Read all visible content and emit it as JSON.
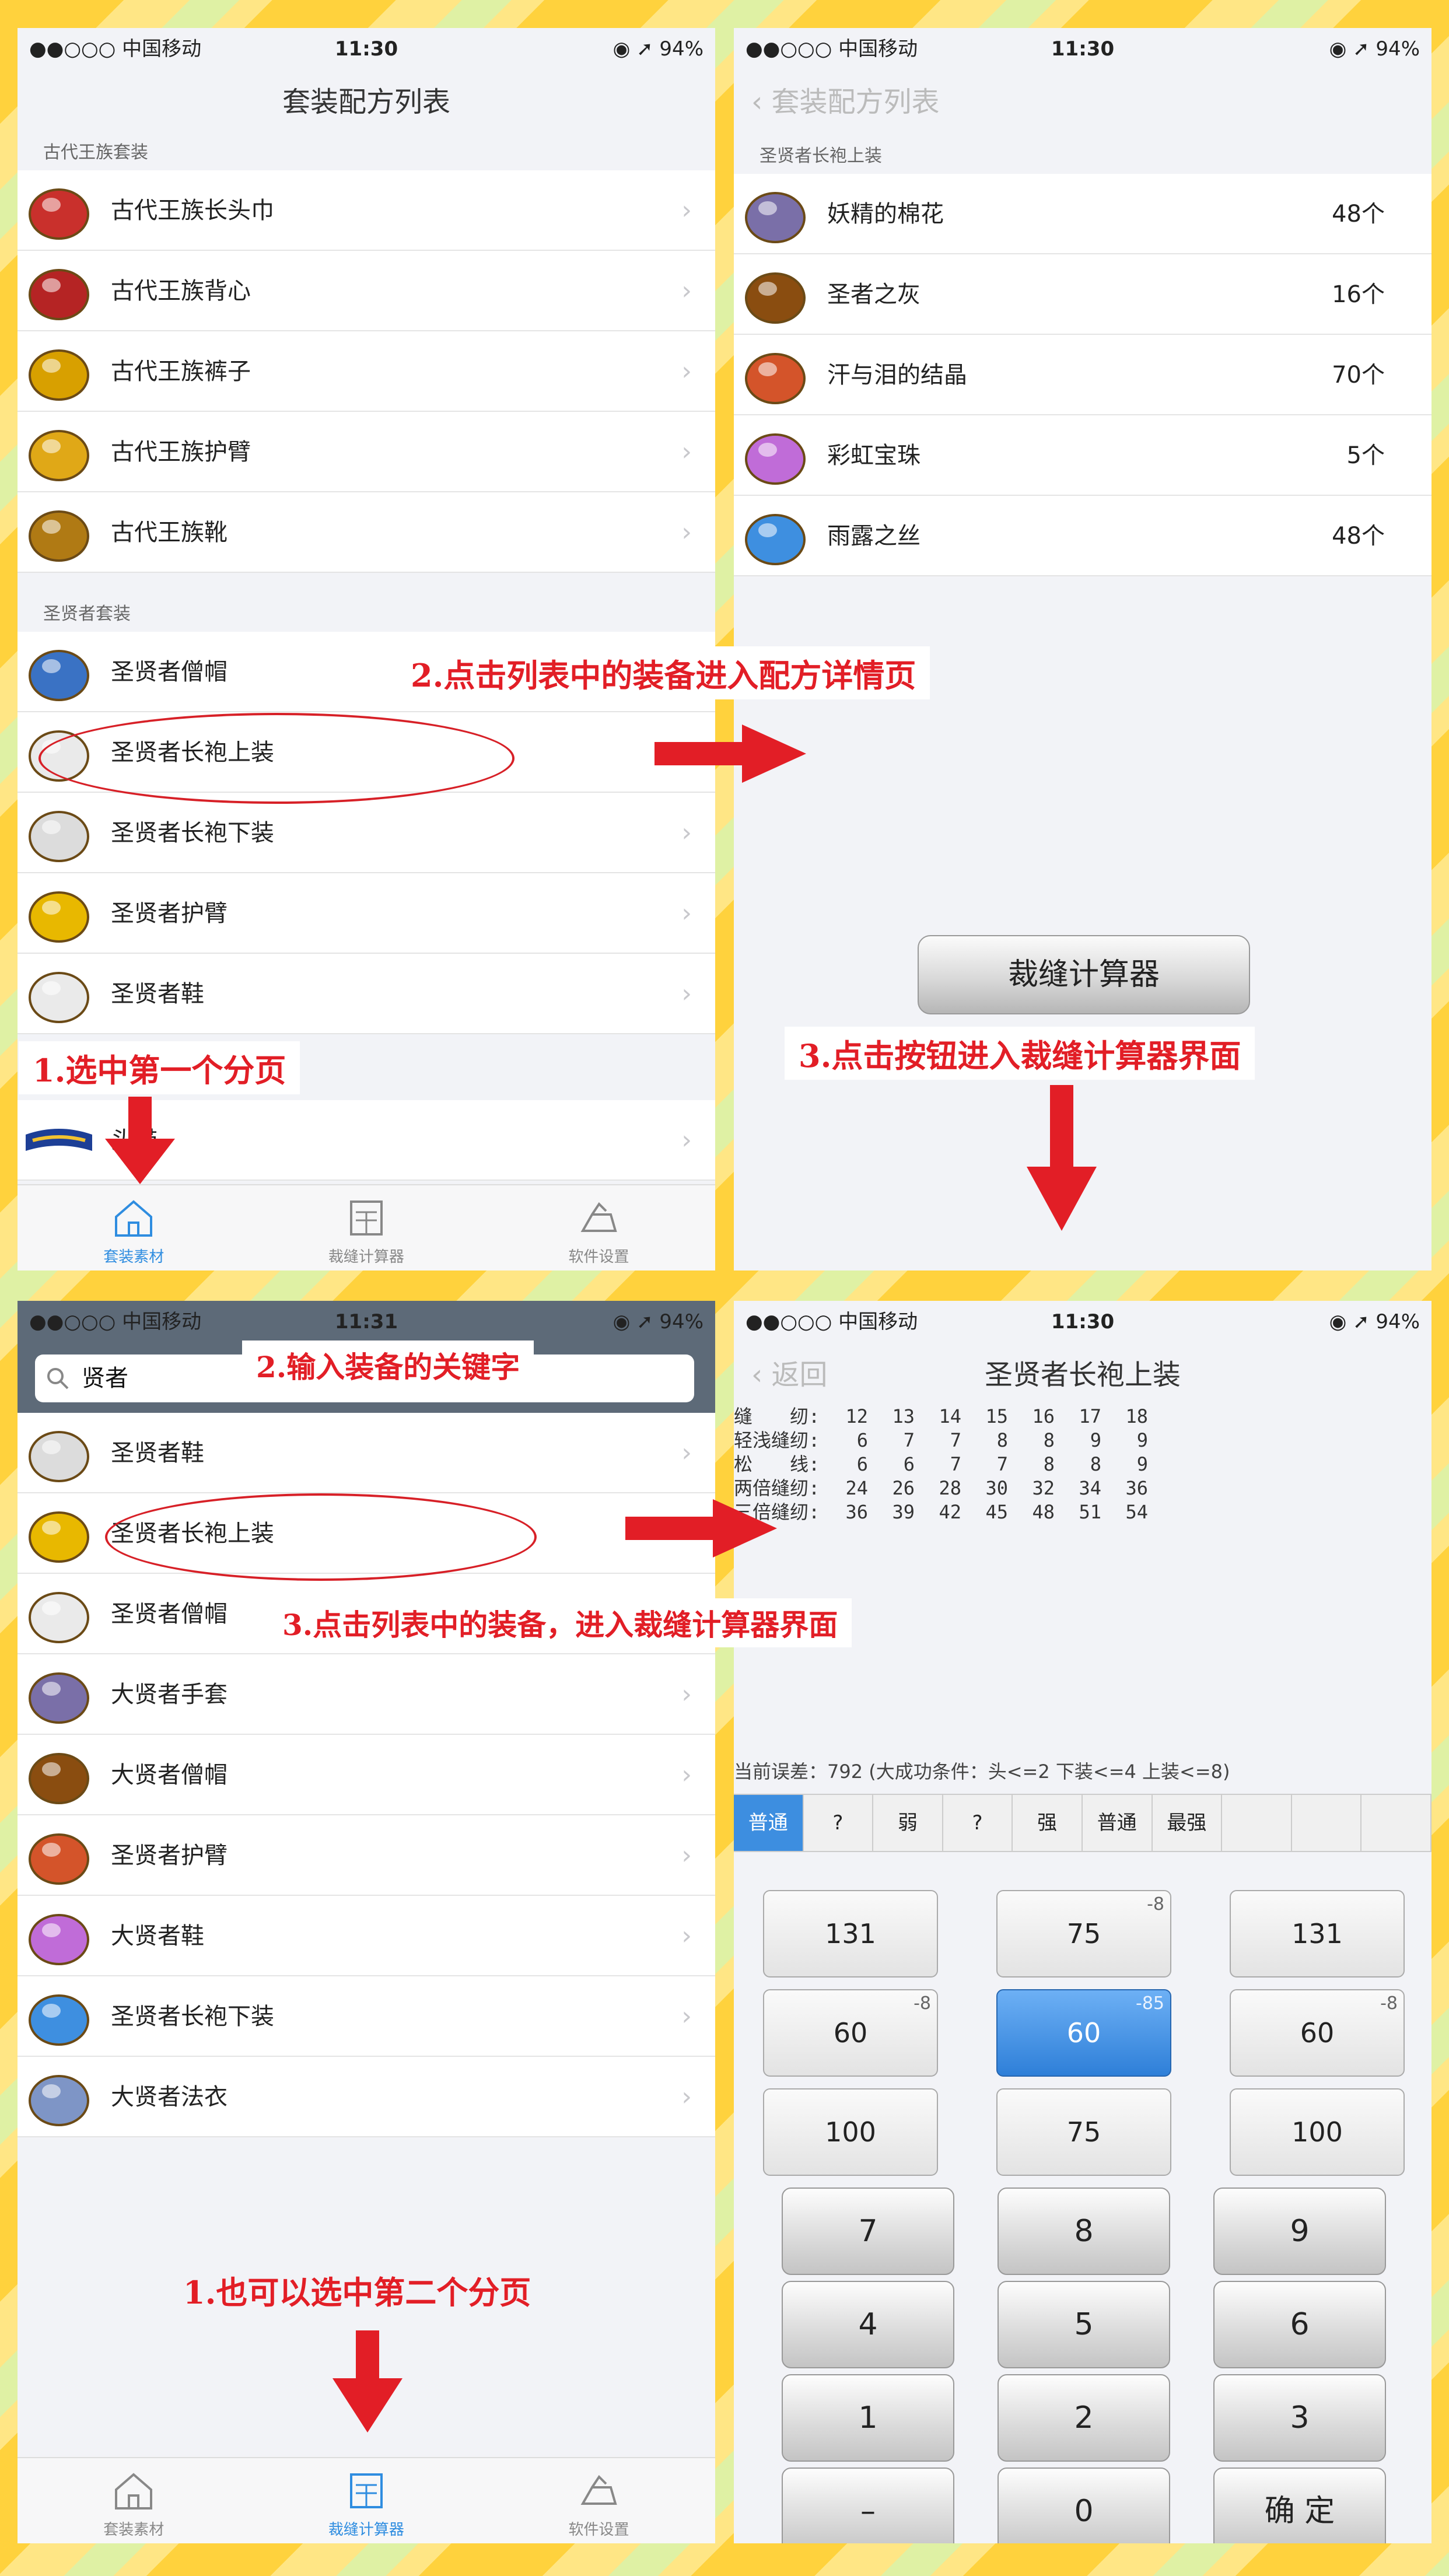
{
  "status_bar": {
    "carrier": "●●○○○ 中国移动",
    "time_a": "11:30",
    "time_b": "11:31",
    "battery": "◉ ➚ 94%"
  },
  "panel1": {
    "title": "套装配方列表",
    "section1": "古代王族套装",
    "section1_items": [
      "古代王族长头巾",
      "古代王族背心",
      "古代王族裤子",
      "古代王族护臂",
      "古代王族靴"
    ],
    "section2": "圣贤者套装",
    "section2_items": [
      "圣贤者僧帽",
      "圣贤者长袍上装",
      "圣贤者长袍下装",
      "圣贤者护臂",
      "圣贤者鞋"
    ],
    "section3_items": [
      "头带"
    ],
    "tabs": [
      "套装素材",
      "裁缝计算器",
      "软件设置"
    ]
  },
  "panel2": {
    "back_label": "套装配方列表",
    "section": "圣贤者长袍上装",
    "materials": [
      {
        "name": "妖精的棉花",
        "count": "48个"
      },
      {
        "name": "圣者之灰",
        "count": "16个"
      },
      {
        "name": "汗与泪的结晶",
        "count": "70个"
      },
      {
        "name": "彩虹宝珠",
        "count": "5个"
      },
      {
        "name": "雨露之丝",
        "count": "48个"
      }
    ],
    "button_label": "裁缝计算器"
  },
  "panel3": {
    "search_value": "贤者",
    "items": [
      "圣贤者鞋",
      "圣贤者长袍上装",
      "圣贤者僧帽",
      "大贤者手套",
      "大贤者僧帽",
      "圣贤者护臂",
      "大贤者鞋",
      "圣贤者长袍下装",
      "大贤者法衣"
    ],
    "tabs": [
      "套装素材",
      "裁缝计算器",
      "软件设置"
    ]
  },
  "panel4": {
    "back_label": "返回",
    "title": "圣贤者长袍上装",
    "table": [
      {
        "label": "缝　　纫:",
        "values": [
          "12",
          "13",
          "14",
          "15",
          "16",
          "17",
          "18"
        ]
      },
      {
        "label": "轻浅缝纫:",
        "values": [
          "6",
          "7",
          "7",
          "8",
          "8",
          "9",
          "9"
        ]
      },
      {
        "label": "松　　线:",
        "values": [
          "6",
          "6",
          "7",
          "7",
          "8",
          "8",
          "9"
        ]
      },
      {
        "label": "两倍缝纫:",
        "values": [
          "24",
          "26",
          "28",
          "30",
          "32",
          "34",
          "36"
        ]
      },
      {
        "label": "三倍缝纫:",
        "values": [
          "36",
          "39",
          "42",
          "45",
          "48",
          "51",
          "54"
        ]
      }
    ],
    "error_text": "当前误差：792 (大成功条件：头<=2 下装<=4 上装<=8)",
    "segments": [
      "普通",
      "?",
      "弱",
      "?",
      "强",
      "普通",
      "最强",
      "",
      "",
      ""
    ],
    "grid": [
      {
        "value": "131",
        "sup": ""
      },
      {
        "value": "75",
        "sup": "-8"
      },
      {
        "value": "131",
        "sup": ""
      },
      {
        "value": "60",
        "sup": "-8"
      },
      {
        "value": "60",
        "sup": "-85"
      },
      {
        "value": "60",
        "sup": "-8"
      },
      {
        "value": "100",
        "sup": ""
      },
      {
        "value": "75",
        "sup": ""
      },
      {
        "value": "100",
        "sup": ""
      }
    ],
    "keypad": [
      "7",
      "8",
      "9",
      "4",
      "5",
      "6",
      "1",
      "2",
      "3",
      "–",
      "0",
      "确 定"
    ]
  },
  "annotations": {
    "a1": "1.选中第一个分页",
    "a2": "2.点击列表中的装备进入配方详情页",
    "a3": "3.点击按钮进入裁缝计算器界面",
    "a4": "2.输入装备的关键字",
    "a5": "3.点击列表中的装备，进入裁缝计算器界面",
    "a6": "1.也可以选中第二个分页"
  },
  "colors": {
    "accent": "#2f8de0",
    "annotation": "#e21e26",
    "selected_key": "#3d8ee0"
  }
}
